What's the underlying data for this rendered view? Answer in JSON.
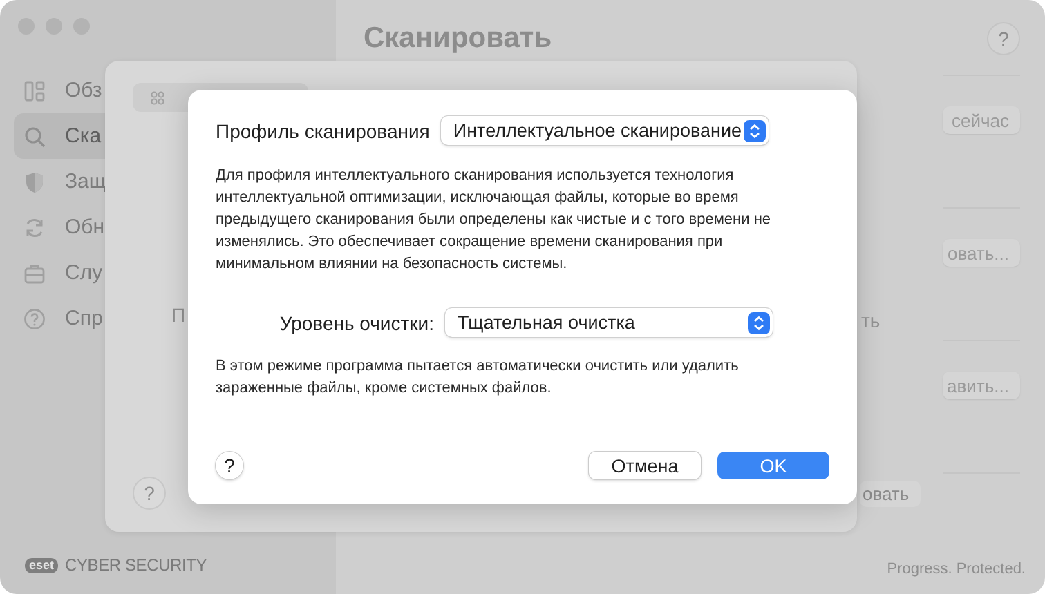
{
  "window": {
    "title": "Сканировать",
    "help": "?"
  },
  "sidebar": {
    "items": [
      {
        "label": "Обз",
        "selected": false
      },
      {
        "label": "Ска",
        "selected": true
      },
      {
        "label": "Защ",
        "selected": false
      },
      {
        "label": "Обн",
        "selected": false
      },
      {
        "label": "Слу",
        "selected": false
      },
      {
        "label": "Спр",
        "selected": false
      }
    ],
    "logo": "eset",
    "brand": "CYBER SECURITY"
  },
  "main": {
    "buttons": [
      {
        "label": "сейчас"
      },
      {
        "label": "овать..."
      },
      {
        "label": "авить..."
      }
    ],
    "fragment": "ть",
    "bottom_button": "овать",
    "footer": "Progress. Protected."
  },
  "sheet": {
    "fragment": "П",
    "help": "?"
  },
  "dialog": {
    "profile_label": "Профиль сканирования",
    "profile_value": "Интеллектуальное сканирование",
    "profile_description": "Для профиля интеллектуального сканирования используется технология интеллектуальной оптимизации, исключающая файлы, которые во время предыдущего сканирования были определены как чистые и с того времени не изменялись. Это обеспечивает сокращение времени сканирования при минимальном влиянии на безопасность системы.",
    "clean_label": "Уровень очистки:",
    "clean_value": "Тщательная очистка",
    "clean_description": "В этом режиме программа пытается автоматически очистить или удалить зараженные файлы, кроме системных файлов.",
    "help": "?",
    "buttons": [
      {
        "label": "Отмена",
        "kind": "secondary"
      },
      {
        "label": "OK",
        "kind": "primary"
      }
    ]
  }
}
